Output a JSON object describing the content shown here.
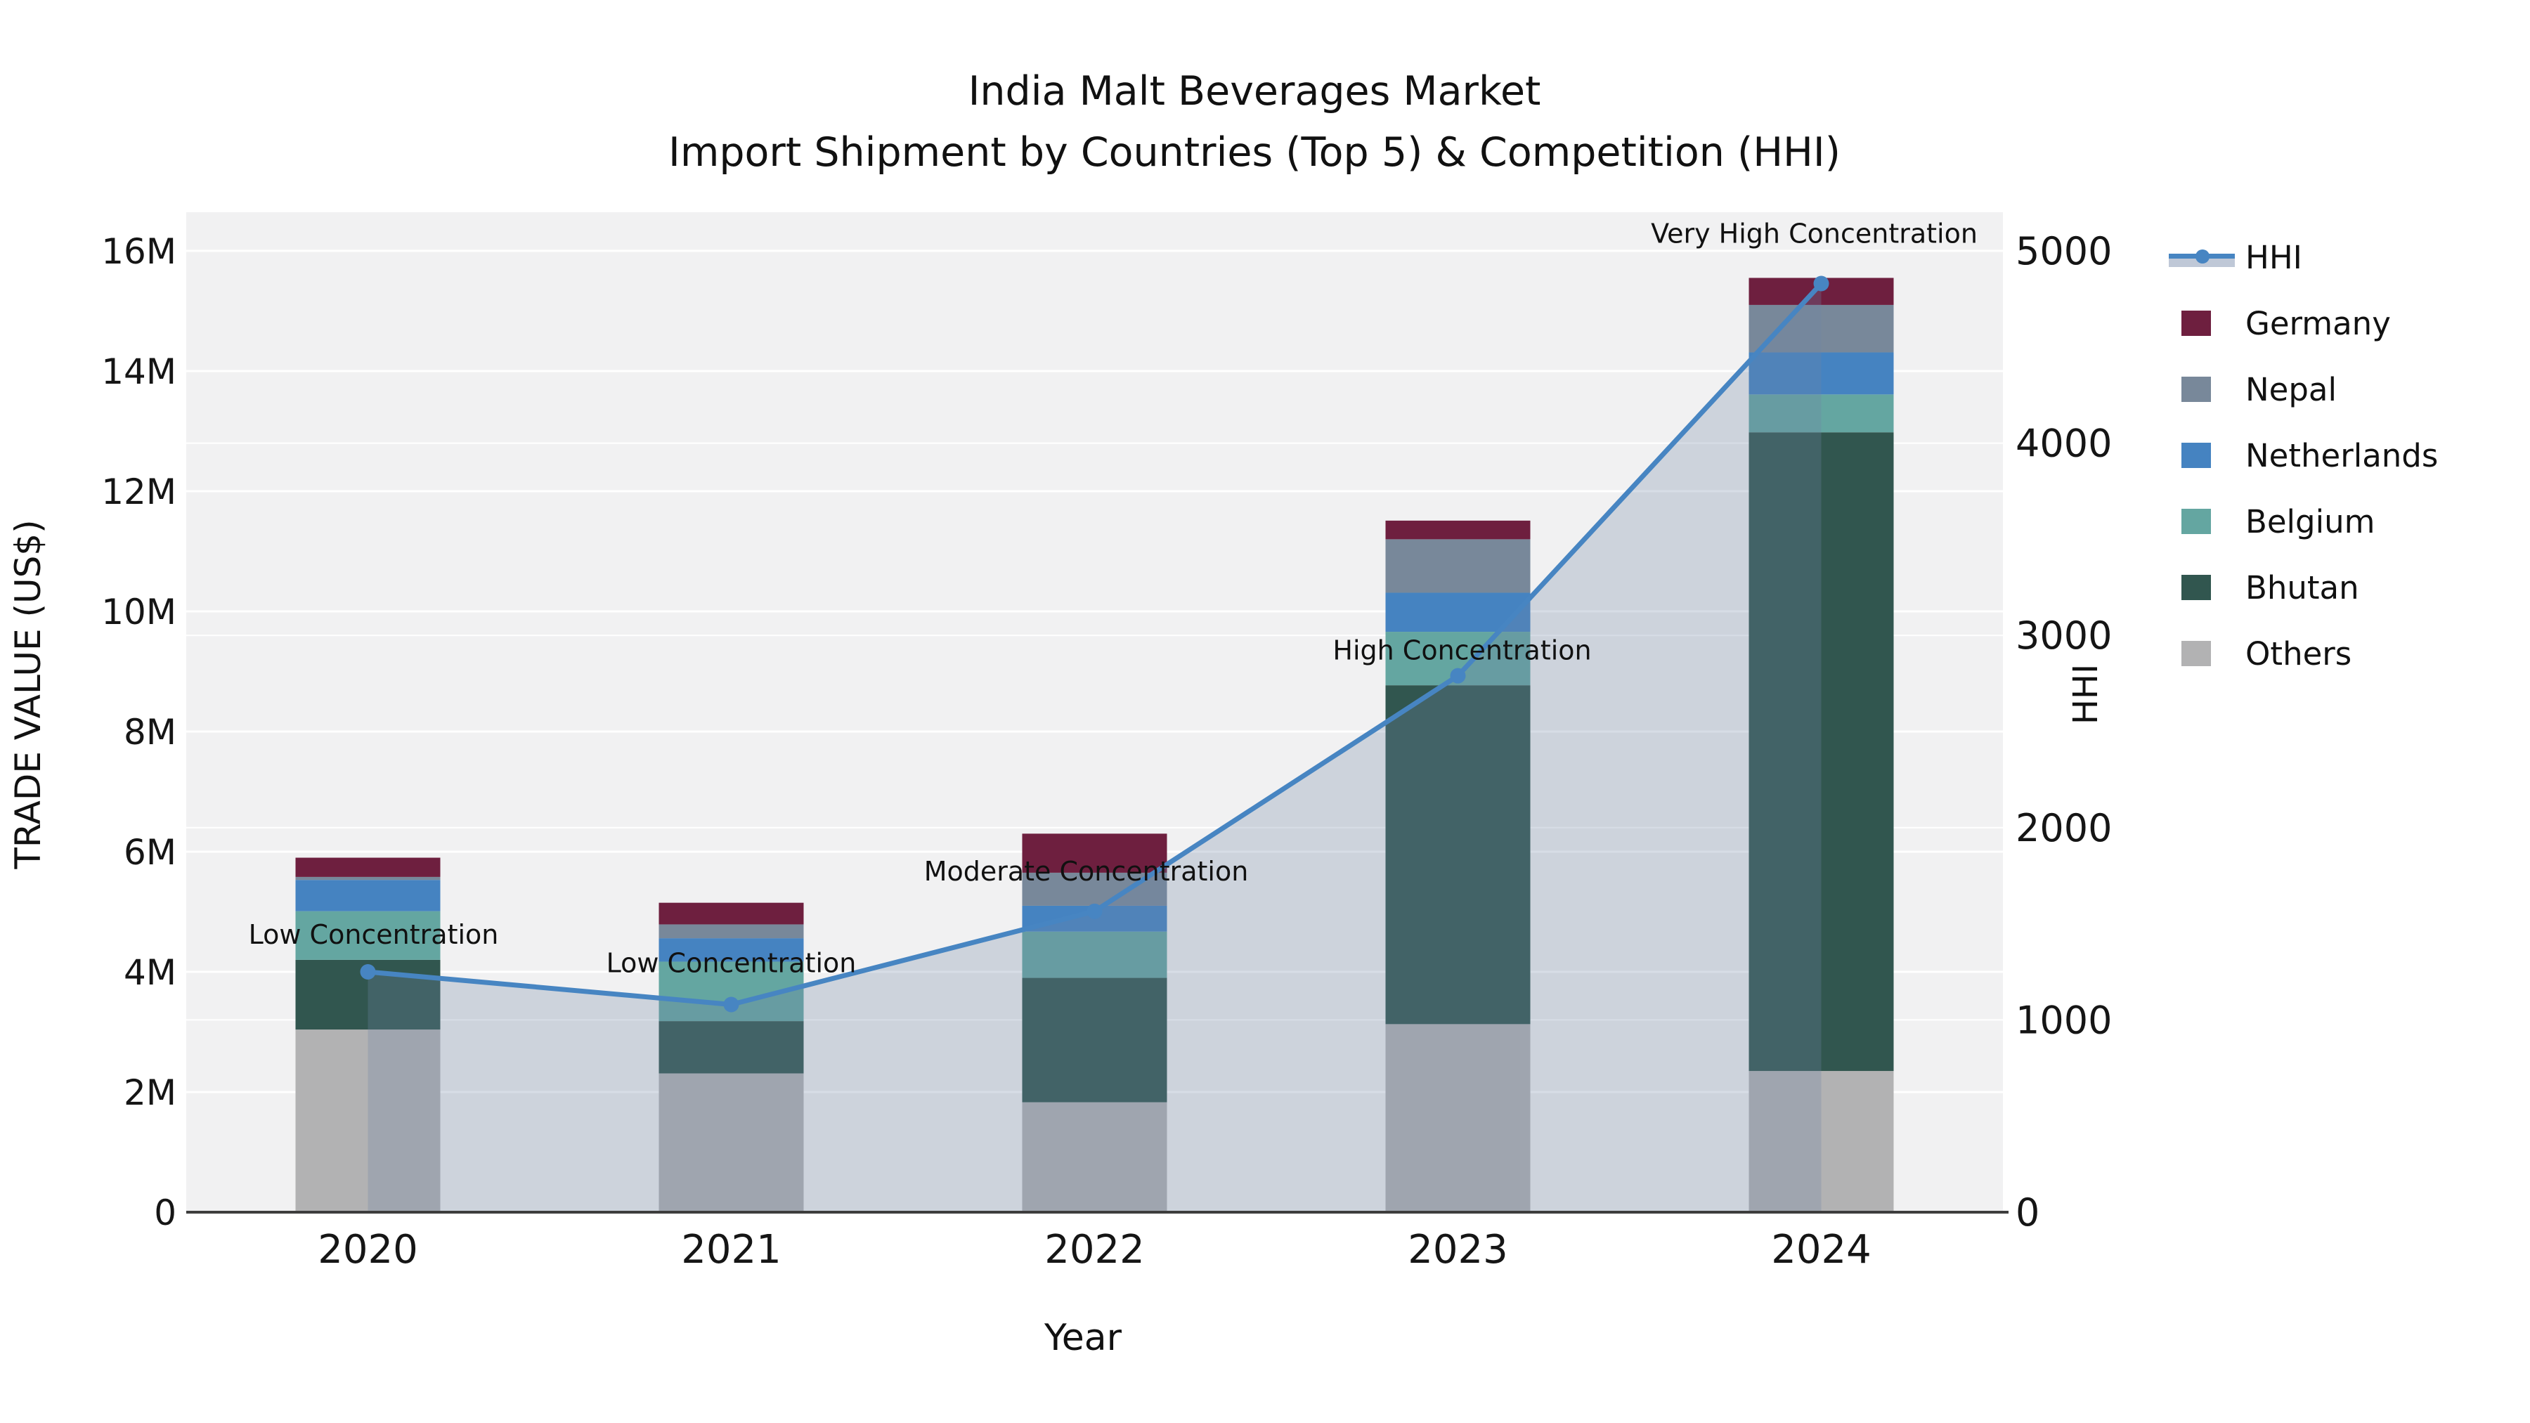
{
  "figure": {
    "title_line1": "India Malt Beverages Market",
    "title_line2": "Import Shipment by Countries (Top 5) & Competition (HHI)",
    "xlabel": "Year",
    "ylabel_left": "TRADE VALUE (US$)",
    "ylabel_right": "HHI"
  },
  "chart_data": {
    "type": "bar",
    "stacked": true,
    "title": "India Malt Beverages Market — Import Shipment by Countries (Top 5) & Competition (HHI)",
    "xlabel": "Year",
    "ylabel": "TRADE VALUE (US$)",
    "ylabel_right": "HHI",
    "categories": [
      "2020",
      "2021",
      "2022",
      "2023",
      "2024"
    ],
    "series": [
      {
        "name": "Germany",
        "color": "#6e1f3f",
        "values": [
          320000,
          360000,
          650000,
          310000,
          450000
        ]
      },
      {
        "name": "Nepal",
        "color": "#78889a",
        "values": [
          50000,
          230000,
          550000,
          890000,
          790000
        ]
      },
      {
        "name": "Netherlands",
        "color": "#4583c1",
        "values": [
          520000,
          390000,
          430000,
          650000,
          700000
        ]
      },
      {
        "name": "Belgium",
        "color": "#64a6a1",
        "values": [
          810000,
          990000,
          770000,
          890000,
          630000
        ]
      },
      {
        "name": "Bhutan",
        "color": "#31564f",
        "values": [
          1160000,
          870000,
          2070000,
          5640000,
          10630000
        ]
      },
      {
        "name": "Others",
        "color": "#b2b2b3",
        "values": [
          3040000,
          2310000,
          1830000,
          3130000,
          2350000
        ]
      }
    ],
    "stack_order_bottom_to_top": [
      "Others",
      "Bhutan",
      "Belgium",
      "Netherlands",
      "Nepal",
      "Germany"
    ],
    "bar_totals": [
      5900000,
      5150000,
      6300000,
      11510000,
      15550000
    ],
    "line_series": {
      "name": "HHI",
      "axis": "right",
      "color": "#4785c2",
      "area_fill": "rgba(112,132,166,0.28)",
      "values": [
        1250,
        1080,
        1565,
        2790,
        4830
      ]
    },
    "annotations": [
      {
        "category": "2020",
        "text": "Low Concentration",
        "dx": 8,
        "dy": -40
      },
      {
        "category": "2021",
        "text": "Low Concentration",
        "dx": 0,
        "dy": -46
      },
      {
        "category": "2022",
        "text": "Moderate Concentration",
        "dx": -12,
        "dy": -44
      },
      {
        "category": "2023",
        "text": "High Concentration",
        "dx": 6,
        "dy": -23
      },
      {
        "category": "2024",
        "text": "Very High Concentration",
        "dx": -10,
        "dy": -58
      }
    ],
    "axis_left": {
      "range": [
        0,
        16643000
      ],
      "ticks": [
        0,
        2000000,
        4000000,
        6000000,
        8000000,
        10000000,
        12000000,
        14000000,
        16000000
      ],
      "tick_labels": [
        "0",
        "2M",
        "4M",
        "6M",
        "8M",
        "10M",
        "12M",
        "14M",
        "16M"
      ]
    },
    "axis_right": {
      "range": [
        0,
        5201
      ],
      "ticks": [
        0,
        1000,
        2000,
        3000,
        4000,
        5000
      ],
      "tick_labels": [
        "0",
        "1000",
        "2000",
        "3000",
        "4000",
        "5000"
      ]
    },
    "grid": true,
    "plot_background": "#f1f1f2",
    "legend_position": "right"
  },
  "legend": {
    "items": [
      {
        "label": "HHI",
        "type": "line",
        "color": "#4785c2"
      },
      {
        "label": "Germany",
        "type": "patch",
        "color": "#6e1f3f"
      },
      {
        "label": "Nepal",
        "type": "patch",
        "color": "#78889a"
      },
      {
        "label": "Netherlands",
        "type": "patch",
        "color": "#4583c1"
      },
      {
        "label": "Belgium",
        "type": "patch",
        "color": "#64a6a1"
      },
      {
        "label": "Bhutan",
        "type": "patch",
        "color": "#31564f"
      },
      {
        "label": "Others",
        "type": "patch",
        "color": "#b2b2b3"
      }
    ]
  }
}
